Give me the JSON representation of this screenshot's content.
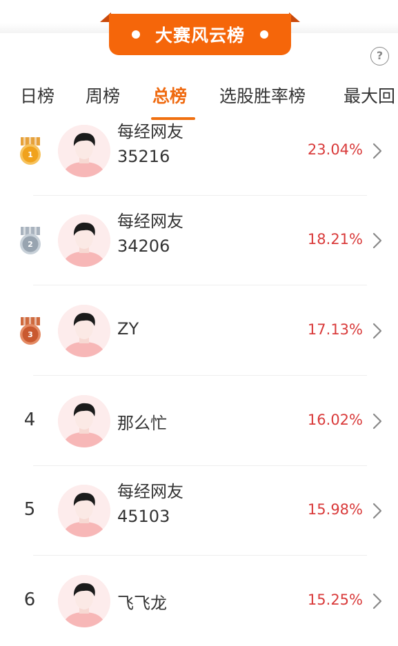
{
  "banner": {
    "title": "大赛风云榜"
  },
  "tabs": [
    {
      "label": "日榜"
    },
    {
      "label": "周榜"
    },
    {
      "label": "总榜"
    },
    {
      "label": "选股胜率榜"
    },
    {
      "label": "最大回"
    }
  ],
  "active_tab": "总榜",
  "help_symbol": "?",
  "leaderboard": [
    {
      "rank": "1",
      "medal": "gold",
      "name": "每经网友",
      "sub": "35216",
      "return": "23.04%"
    },
    {
      "rank": "2",
      "medal": "silver",
      "name": "每经网友",
      "sub": "34206",
      "return": "18.21%"
    },
    {
      "rank": "3",
      "medal": "bronze",
      "name": "ZY",
      "sub": "",
      "return": "17.13%"
    },
    {
      "rank": "4",
      "medal": "",
      "name": "那么忙",
      "sub": "",
      "return": "16.02%"
    },
    {
      "rank": "5",
      "medal": "",
      "name": "每经网友",
      "sub": "45103",
      "return": "15.98%"
    },
    {
      "rank": "6",
      "medal": "",
      "name": "飞飞龙",
      "sub": "",
      "return": "15.25%"
    }
  ],
  "colors": {
    "accent_orange": "#f5660a",
    "return_red": "#d93a3a",
    "gold": "#e9a22a",
    "silver": "#9aa6b2",
    "bronze": "#c8663e"
  }
}
